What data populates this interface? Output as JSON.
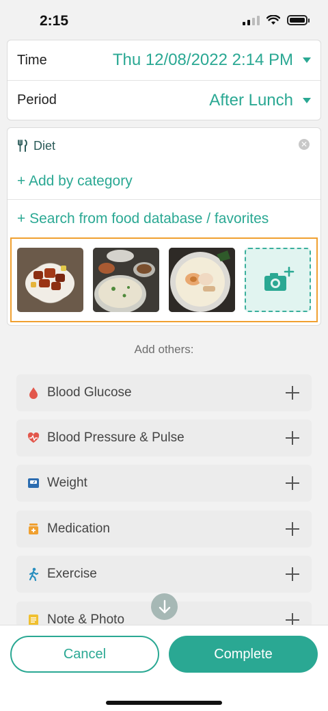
{
  "status_bar": {
    "time": "2:15"
  },
  "entry": {
    "time_label": "Time",
    "time_value": "Thu 12/08/2022 2:14 PM",
    "period_label": "Period",
    "period_value": "After Lunch"
  },
  "diet": {
    "title": "Diet",
    "add_by_category": "+ Add by category",
    "search_database": "+ Search from food database / favorites",
    "photos": [
      "braised-pork-photo",
      "congee-meal-photo",
      "ramen-bowl-photo"
    ]
  },
  "add_others": {
    "heading": "Add others:",
    "items": [
      {
        "label": "Blood Glucose",
        "icon": "blood-drop-icon",
        "color": "#e2574c"
      },
      {
        "label": "Blood Pressure & Pulse",
        "icon": "heart-pulse-icon",
        "color": "#e2574c"
      },
      {
        "label": "Weight",
        "icon": "scale-icon",
        "color": "#2b6cb0"
      },
      {
        "label": "Medication",
        "icon": "medication-icon",
        "color": "#f0a030"
      },
      {
        "label": "Exercise",
        "icon": "walking-icon",
        "color": "#2a8fbf"
      },
      {
        "label": "Note & Photo",
        "icon": "note-icon",
        "color": "#f0c030"
      }
    ]
  },
  "actions": {
    "cancel": "Cancel",
    "complete": "Complete"
  },
  "colors": {
    "accent": "#2aa893",
    "highlight_border": "#f0a030"
  }
}
